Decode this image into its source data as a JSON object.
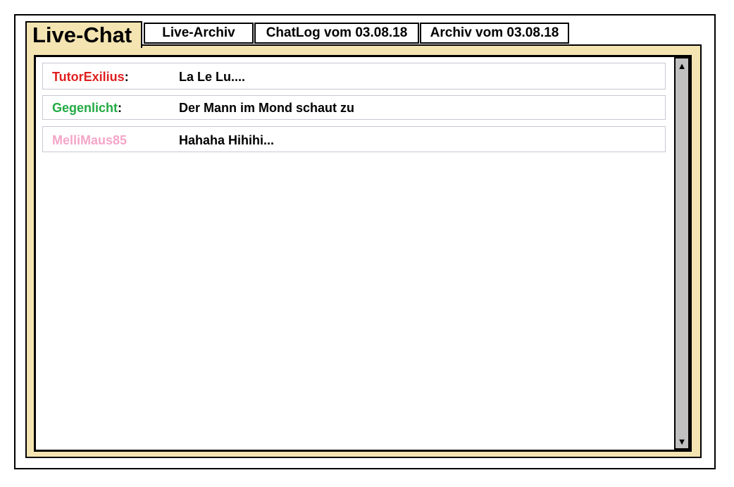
{
  "tabs": {
    "active": "Live-Chat",
    "items": [
      {
        "label": "Live-Archiv"
      },
      {
        "label": "ChatLog vom 03.08.18"
      },
      {
        "label": "Archiv vom 03.08.18"
      }
    ]
  },
  "colors": {
    "panel_bg": "#f3e4b1",
    "user_red": "#e02020",
    "user_green": "#22aa44",
    "user_pink": "#f5a6c8"
  },
  "messages": [
    {
      "user": "TutorExilius",
      "colon": ":",
      "text": "La Le Lu...."
    },
    {
      "user": "Gegenlicht",
      "colon": ":",
      "text": "Der Mann im Mond schaut zu"
    },
    {
      "user": "MelliMaus85",
      "colon": "",
      "text": "Hahaha Hihihi..."
    }
  ],
  "scrollbar": {
    "up_icon": "arrow-up-icon",
    "down_icon": "arrow-down-icon"
  }
}
